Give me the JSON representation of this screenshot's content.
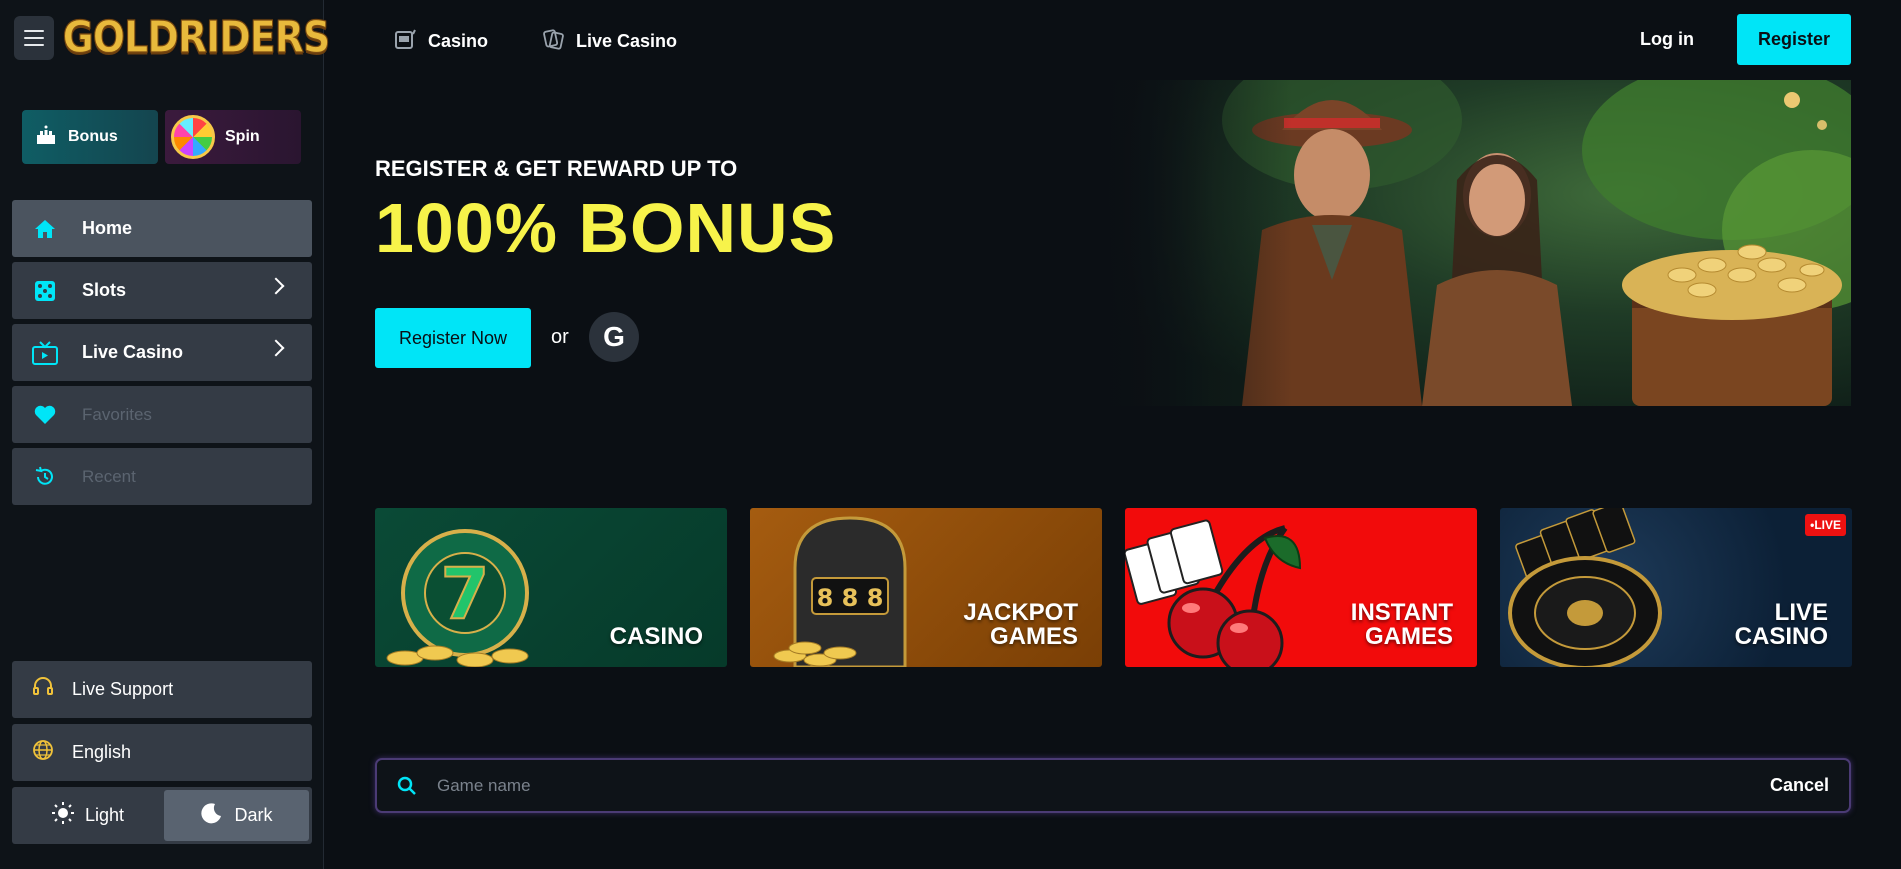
{
  "brand": {
    "logo_text": "GOLDRIDERS"
  },
  "sidebar": {
    "promos": [
      {
        "label": "Bonus"
      },
      {
        "label": "Spin"
      }
    ],
    "items": [
      {
        "label": "Home"
      },
      {
        "label": "Slots"
      },
      {
        "label": "Live Casino"
      },
      {
        "label": "Favorites"
      },
      {
        "label": "Recent"
      }
    ],
    "support_label": "Live Support",
    "language_label": "English",
    "theme": {
      "light": "Light",
      "dark": "Dark",
      "selected": "Dark"
    }
  },
  "topnav": {
    "items": [
      {
        "label": "Casino"
      },
      {
        "label": "Live Casino"
      }
    ],
    "login_label": "Log in",
    "register_label": "Register"
  },
  "hero": {
    "subtitle": "REGISTER & GET REWARD UP TO",
    "title": "100% BONUS",
    "cta_label": "Register Now",
    "or_text": "or",
    "google_label": "G"
  },
  "categories": [
    {
      "label": "CASINO"
    },
    {
      "label": "JACKPOT\nGAMES"
    },
    {
      "label": "INSTANT\nGAMES"
    },
    {
      "label": "LIVE\nCASINO",
      "badge": "•LIVE"
    }
  ],
  "search": {
    "placeholder": "Game name",
    "cancel_label": "Cancel"
  },
  "colors": {
    "accent": "#00e5f7",
    "headline": "#f7f34a",
    "bg": "#0b0f14",
    "panel": "#343b45"
  }
}
